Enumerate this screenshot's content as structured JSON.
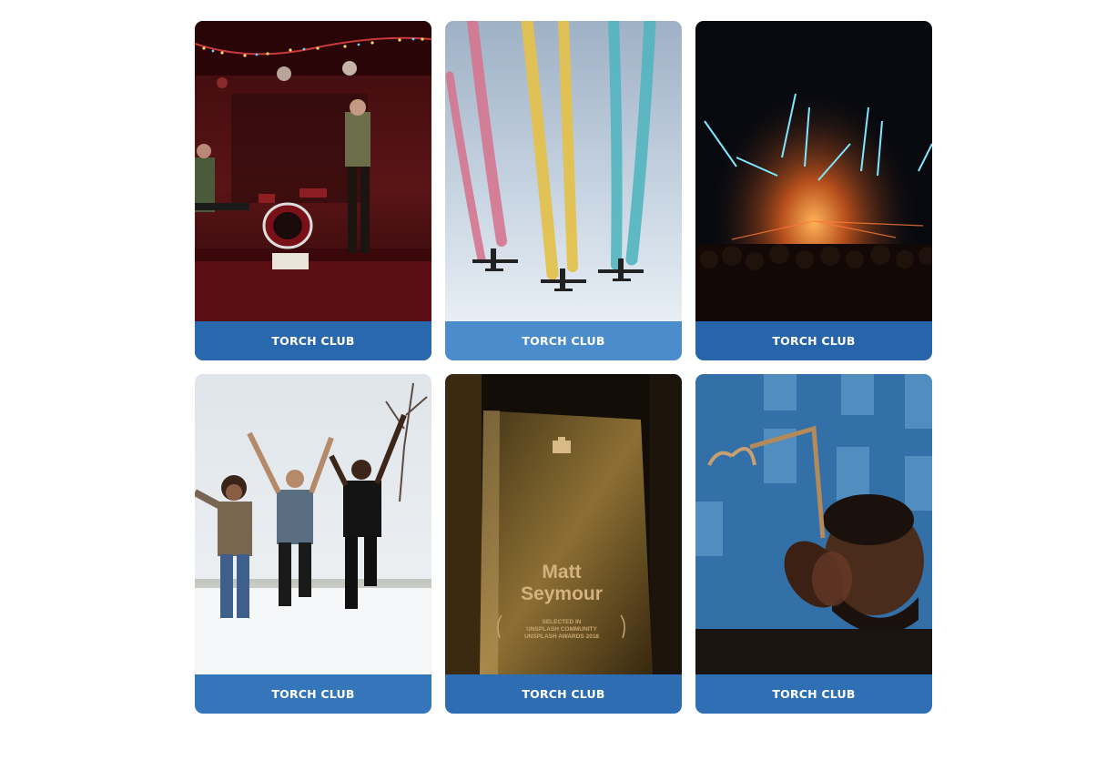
{
  "gallery": {
    "cards": [
      {
        "label": "TORCH CLUB",
        "photo": "band-on-stage-photo"
      },
      {
        "label": "TORCH CLUB",
        "photo": "airshow-colored-smoke-photo"
      },
      {
        "label": "TORCH CLUB",
        "photo": "concert-lasers-crowd-photo"
      },
      {
        "label": "TORCH CLUB",
        "photo": "friends-jumping-snow-photo"
      },
      {
        "label": "TORCH CLUB",
        "photo": "award-trophy-photo"
      },
      {
        "label": "TORCH CLUB",
        "photo": "man-with-emmy-award-photo"
      }
    ],
    "trophy_text": {
      "name_line1": "Matt",
      "name_line2": "Seymour",
      "line1": "SELECTED IN",
      "line2": "UNSPLASH COMMUNITY",
      "line3": "UNSPLASH AWARDS 2018"
    }
  },
  "colors": {
    "caption_blue": "#2a68ad",
    "caption_light_blue": "#4a8ccc"
  }
}
